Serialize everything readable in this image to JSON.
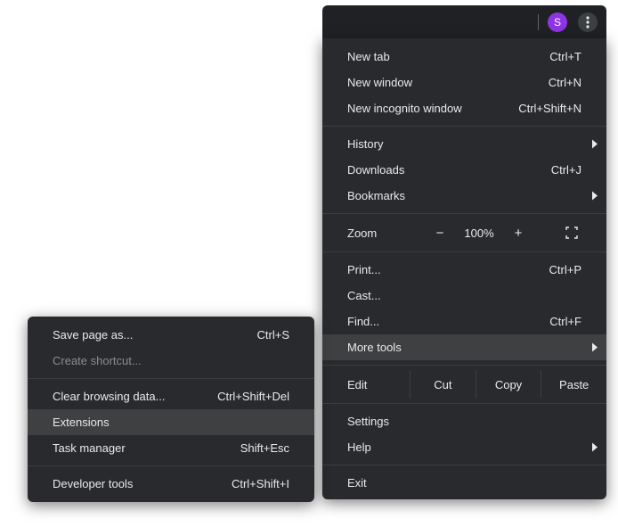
{
  "toolbar": {
    "avatar_letter": "S",
    "avatar_color": "#8d34e4"
  },
  "menu": {
    "new_tab": {
      "label": "New tab",
      "shortcut": "Ctrl+T"
    },
    "new_window": {
      "label": "New window",
      "shortcut": "Ctrl+N"
    },
    "new_incognito": {
      "label": "New incognito window",
      "shortcut": "Ctrl+Shift+N"
    },
    "history": {
      "label": "History"
    },
    "downloads": {
      "label": "Downloads",
      "shortcut": "Ctrl+J"
    },
    "bookmarks": {
      "label": "Bookmarks"
    },
    "zoom": {
      "label": "Zoom",
      "minus": "−",
      "value": "100%",
      "plus": "+"
    },
    "print": {
      "label": "Print...",
      "shortcut": "Ctrl+P"
    },
    "cast": {
      "label": "Cast..."
    },
    "find": {
      "label": "Find...",
      "shortcut": "Ctrl+F"
    },
    "more_tools": {
      "label": "More tools"
    },
    "edit": {
      "label": "Edit",
      "cut": "Cut",
      "copy": "Copy",
      "paste": "Paste"
    },
    "settings": {
      "label": "Settings"
    },
    "help": {
      "label": "Help"
    },
    "exit": {
      "label": "Exit"
    }
  },
  "submenu": {
    "save_page_as": {
      "label": "Save page as...",
      "shortcut": "Ctrl+S"
    },
    "create_shortcut": {
      "label": "Create shortcut..."
    },
    "clear_browsing_data": {
      "label": "Clear browsing data...",
      "shortcut": "Ctrl+Shift+Del"
    },
    "extensions": {
      "label": "Extensions"
    },
    "task_manager": {
      "label": "Task manager",
      "shortcut": "Shift+Esc"
    },
    "developer_tools": {
      "label": "Developer tools",
      "shortcut": "Ctrl+Shift+I"
    }
  }
}
